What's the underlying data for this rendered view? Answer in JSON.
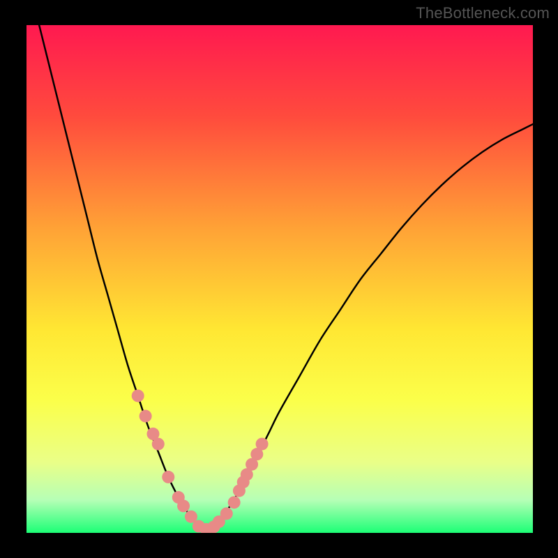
{
  "watermark": "TheBottleneck.com",
  "chart_data": {
    "type": "line",
    "title": "",
    "xlabel": "",
    "ylabel": "",
    "xlim": [
      0,
      100
    ],
    "ylim": [
      0,
      100
    ],
    "grid": false,
    "legend": false,
    "background_gradient_stops": [
      {
        "offset": 0,
        "color": "#ff1950"
      },
      {
        "offset": 0.18,
        "color": "#ff4b3d"
      },
      {
        "offset": 0.4,
        "color": "#ffa236"
      },
      {
        "offset": 0.6,
        "color": "#ffe733"
      },
      {
        "offset": 0.74,
        "color": "#fbff4a"
      },
      {
        "offset": 0.86,
        "color": "#eaff87"
      },
      {
        "offset": 0.935,
        "color": "#b6ffb6"
      },
      {
        "offset": 1.0,
        "color": "#1cff76"
      }
    ],
    "series": [
      {
        "name": "bottleneck-curve",
        "color": "#000000",
        "x": [
          0,
          2,
          4,
          6,
          8,
          10,
          12,
          14,
          16,
          18,
          20,
          22,
          24,
          26,
          28,
          30,
          31.5,
          33,
          34,
          35,
          36,
          37,
          38,
          40,
          42,
          44,
          46,
          48,
          50,
          54,
          58,
          62,
          66,
          70,
          74,
          78,
          82,
          86,
          90,
          94,
          98,
          100
        ],
        "y": [
          110,
          102,
          94,
          86,
          78,
          70,
          62,
          54,
          47,
          40,
          33,
          27,
          21,
          16,
          11,
          7,
          4.5,
          2.5,
          1.3,
          0.7,
          0.7,
          1.2,
          2.2,
          5,
          8.3,
          12,
          16,
          20,
          24,
          31,
          38,
          44,
          50,
          55,
          60,
          64.5,
          68.5,
          72,
          75,
          77.5,
          79.5,
          80.5
        ]
      }
    ],
    "markers": {
      "name": "highlight-points",
      "color": "#e88a87",
      "radius": 9,
      "x": [
        22.0,
        23.5,
        25.0,
        26.0,
        28.0,
        30.0,
        31.0,
        32.5,
        34.0,
        35.5,
        37.0,
        38.0,
        39.5,
        41.0,
        42.0,
        42.8,
        43.5,
        44.5,
        45.5,
        46.5
      ],
      "y": [
        27.0,
        23.0,
        19.5,
        17.5,
        11.0,
        7.0,
        5.3,
        3.2,
        1.3,
        0.7,
        1.2,
        2.2,
        3.8,
        6.0,
        8.3,
        10.0,
        11.5,
        13.5,
        15.5,
        17.5
      ]
    }
  }
}
